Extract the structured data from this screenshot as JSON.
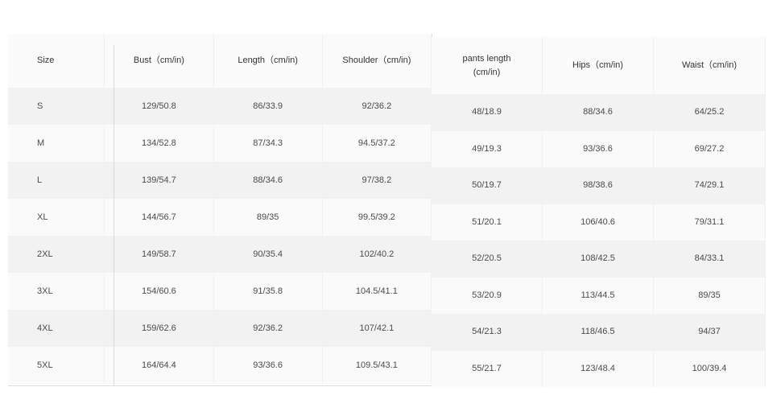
{
  "left_table": {
    "headers": [
      "Size",
      "Bust（cm/in)",
      "Length（cm/in)",
      "Shoulder（cm/in)"
    ],
    "rows": [
      [
        "S",
        "129/50.8",
        "86/33.9",
        "92/36.2"
      ],
      [
        "M",
        "134/52.8",
        "87/34.3",
        "94.5/37.2"
      ],
      [
        "L",
        "139/54.7",
        "88/34.6",
        "97/38.2"
      ],
      [
        "XL",
        "144/56.7",
        "89/35",
        "99.5/39.2"
      ],
      [
        "2XL",
        "149/58.7",
        "90/35.4",
        "102/40.2"
      ],
      [
        "3XL",
        "154/60.6",
        "91/35.8",
        "104.5/41.1"
      ],
      [
        "4XL",
        "159/62.6",
        "92/36.2",
        "107/42.1"
      ],
      [
        "5XL",
        "164/64.4",
        "93/36.6",
        "109.5/43.1"
      ]
    ]
  },
  "right_table": {
    "headers": [
      "pants length\n(cm/in)",
      "Hips（cm/in)",
      "Waist（cm/in)"
    ],
    "rows": [
      [
        "48/18.9",
        "88/34.6",
        "64/25.2"
      ],
      [
        "49/19.3",
        "93/36.6",
        "69/27.2"
      ],
      [
        "50/19.7",
        "98/38.6",
        "74/29.1"
      ],
      [
        "51/20.1",
        "106/40.6",
        "79/31.1"
      ],
      [
        "52/20.5",
        "108/42.5",
        "84/33.1"
      ],
      [
        "53/20.9",
        "113/44.5",
        "89/35"
      ],
      [
        "54/21.3",
        "118/46.5",
        "94/37"
      ],
      [
        "55/21.7",
        "123/48.4",
        "100/39.4"
      ]
    ]
  }
}
